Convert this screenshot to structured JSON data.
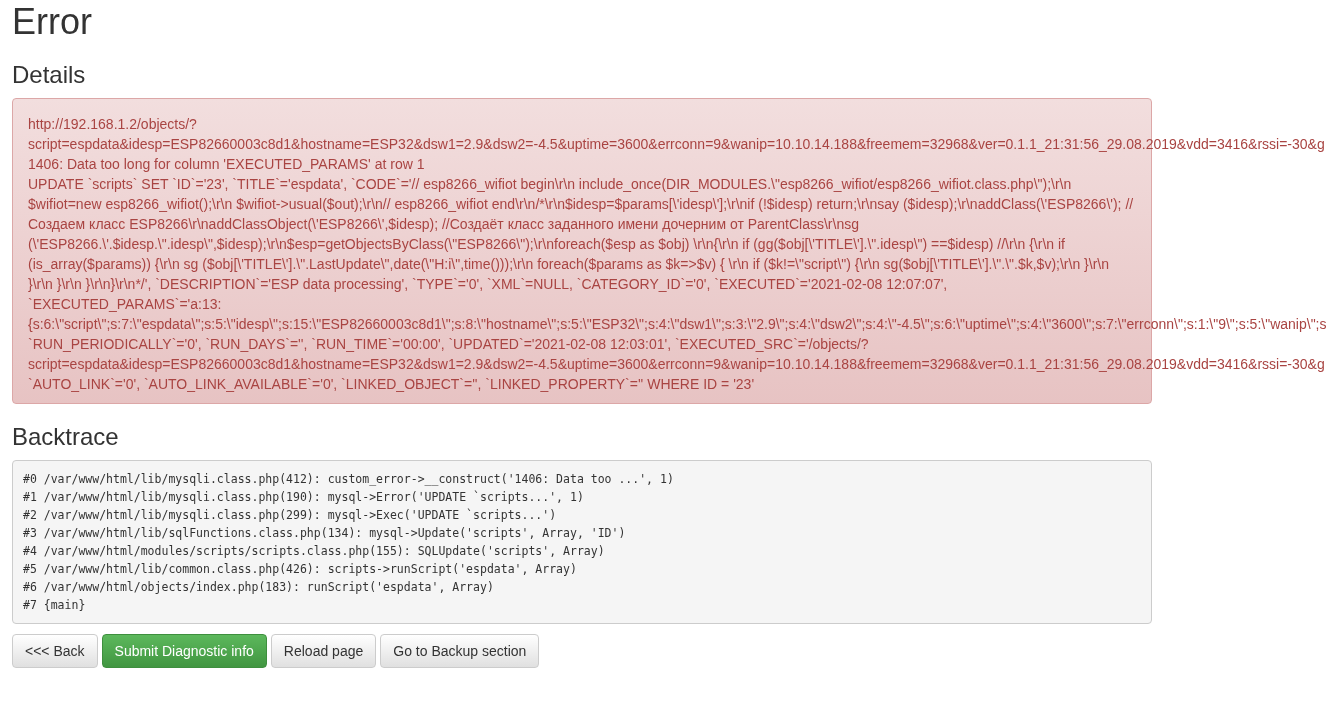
{
  "title": "Error",
  "details": {
    "heading": "Details",
    "lines": [
      "http://192.168.1.2/objects/?",
      "script=espdata&idesp=ESP82660003c8d1&hostname=ESP32&dsw1=2.9&dsw2=-4.5&uptime=3600&errconn=9&wanip=10.10.14.188&freemem=32968&ver=0.1.1_21:31:56_29.08.2019&vdd=3416&rssi=-30&g",
      "1406: Data too long for column 'EXECUTED_PARAMS' at row 1",
      "UPDATE `scripts` SET `ID`='23', `TITLE`='espdata', `CODE`='// esp8266_wifiot begin\\r\\n include_once(DIR_MODULES.\\\"esp8266_wifiot/esp8266_wifiot.class.php\\\");\\r\\n",
      "$wifiot=new esp8266_wifiot();\\r\\n $wifiot->usual($out);\\r\\n// esp8266_wifiot end\\r\\n/*\\r\\n$idesp=$params[\\'idesp\\'];\\r\\nif (!$idesp) return;\\r\\nsay ($idesp);\\r\\naddClass(\\'ESP8266\\'); //",
      "Создаем класс ESP8266\\r\\naddClassObject(\\'ESP8266\\',$idesp); //Создаёт класс заданного имени дочерним от ParentClass\\r\\nsg",
      "(\\'ESP8266.\\'.$idesp.\\\".idesp\\\",$idesp);\\r\\n$esp=getObjectsByClass(\\\"ESP8266\\\");\\r\\nforeach($esp as $obj) \\r\\n{\\r\\n if (gg($obj[\\'TITLE\\'].\\\".idesp\\\") ==$idesp) //\\r\\n {\\r\\n if",
      "(is_array($params)) {\\r\\n sg ($obj[\\'TITLE\\'].\\\".LastUpdate\\\",date(\\\"H:i\\\",time()));\\r\\n foreach($params as $k=>$v) { \\r\\n if ($k!=\\\"script\\\") {\\r\\n sg($obj[\\'TITLE\\'].\\\".\\\".$k,$v);\\r\\n }\\r\\n",
      "}\\r\\n }\\r\\n }\\r\\n}\\r\\n*/', `DESCRIPTION`='ESP data processing', `TYPE`='0', `XML`=NULL, `CATEGORY_ID`='0', `EXECUTED`='2021-02-08 12:07:07',",
      "`EXECUTED_PARAMS`='a:13:",
      "{s:6:\\\"script\\\";s:7:\\\"espdata\\\";s:5:\\\"idesp\\\";s:15:\\\"ESP82660003c8d1\\\";s:8:\\\"hostname\\\";s:5:\\\"ESP32\\\";s:4:\\\"dsw1\\\";s:3:\\\"2.9\\\";s:4:\\\"dsw2\\\";s:4:\\\"-4.5\\\";s:6:\\\"uptime\\\";s:4:\\\"3600\\\";s:7:\\\"errconn\\\";s:1:\\\"9\\\";s:5:\\\"wanip\\\";s",
      "`RUN_PERIODICALLY`='0', `RUN_DAYS`='', `RUN_TIME`='00:00', `UPDATED`='2021-02-08 12:03:01', `EXECUTED_SRC`='/objects/?",
      "script=espdata&idesp=ESP82660003c8d1&hostname=ESP32&dsw1=2.9&dsw2=-4.5&uptime=3600&errconn=9&wanip=10.10.14.188&freemem=32968&ver=0.1.1_21:31:56_29.08.2019&vdd=3416&rssi=-30&g",
      "`AUTO_LINK`='0', `AUTO_LINK_AVAILABLE`='0', `LINKED_OBJECT`='', `LINKED_PROPERTY`='' WHERE ID = '23'"
    ]
  },
  "backtrace": {
    "heading": "Backtrace",
    "lines": [
      "#0 /var/www/html/lib/mysqli.class.php(412): custom_error->__construct('1406: Data too ...', 1)",
      "#1 /var/www/html/lib/mysqli.class.php(190): mysql->Error('UPDATE `scripts...', 1)",
      "#2 /var/www/html/lib/mysqli.class.php(299): mysql->Exec('UPDATE `scripts...')",
      "#3 /var/www/html/lib/sqlFunctions.class.php(134): mysql->Update('scripts', Array, 'ID')",
      "#4 /var/www/html/modules/scripts/scripts.class.php(155): SQLUpdate('scripts', Array)",
      "#5 /var/www/html/lib/common.class.php(426): scripts->runScript('espdata', Array)",
      "#6 /var/www/html/objects/index.php(183): runScript('espdata', Array)",
      "#7 {main}"
    ]
  },
  "buttons": [
    {
      "label": "<<< Back",
      "kind": "default"
    },
    {
      "label": "Submit Diagnostic info",
      "kind": "success"
    },
    {
      "label": "Reload page",
      "kind": "default"
    },
    {
      "label": "Go to Backup section",
      "kind": "default"
    }
  ]
}
